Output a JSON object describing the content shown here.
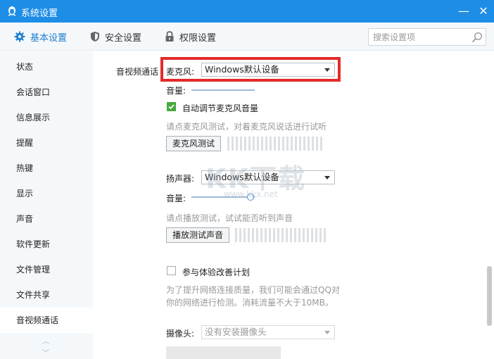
{
  "window": {
    "title": "系统设置",
    "minimize_glyph": "—",
    "close_glyph": "✕"
  },
  "tabs": [
    {
      "label": "基本设置",
      "icon": "gear-icon",
      "active": true
    },
    {
      "label": "安全设置",
      "icon": "shield-icon",
      "active": false
    },
    {
      "label": "权限设置",
      "icon": "lock-icon",
      "active": false
    }
  ],
  "search": {
    "placeholder": "搜索设置项",
    "value": ""
  },
  "sidebar": {
    "items": [
      {
        "label": "状态"
      },
      {
        "label": "会话窗口"
      },
      {
        "label": "信息展示"
      },
      {
        "label": "提醒"
      },
      {
        "label": "热键"
      },
      {
        "label": "显示"
      },
      {
        "label": "声音"
      },
      {
        "label": "软件更新"
      },
      {
        "label": "文件管理"
      },
      {
        "label": "文件共享"
      },
      {
        "label": "音视频通话",
        "active": true
      }
    ],
    "scroll_up": "︿",
    "scroll_down": "﹀"
  },
  "av": {
    "section_label": "音视频通话",
    "mic": {
      "label": "麦克风:",
      "device": "Windows默认设备",
      "volume_label": "音量:",
      "auto_adjust_label": "自动调节麦克风音量",
      "auto_adjust_checked": true,
      "test_hint": "请点麦克风测试，对着麦克风说话进行试听",
      "test_button": "麦克风测试"
    },
    "speaker": {
      "label": "扬声器:",
      "device": "Windows默认设备",
      "volume_label": "音量:",
      "volume_level": 0.6,
      "test_hint": "请点播放测试，试试能否听到声音",
      "test_button": "播放测试声音"
    },
    "experience": {
      "label": "参与体验改善计划",
      "checked": false,
      "desc_line1": "为了提升网络连接质量，我们可能会通过QQ对",
      "desc_line2": "你的网络进行检测。消耗流量不大于10MB。"
    },
    "camera": {
      "label": "摄像头:",
      "device": "没有安装摄像头"
    }
  },
  "watermark": {
    "text": "KK下载",
    "url": "www.kkx.net"
  },
  "colors": {
    "titlebar": "#1e8de6",
    "accent": "#1e7fd0",
    "highlight_border": "#e32b2b",
    "checkbox_on": "#48a83e"
  }
}
